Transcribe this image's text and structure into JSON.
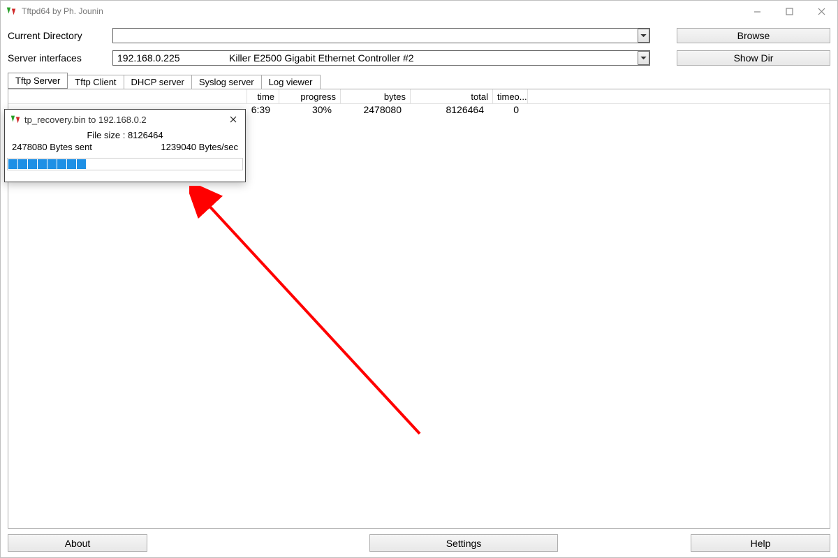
{
  "titlebar": {
    "title": "Tftpd64 by Ph. Jounin"
  },
  "form": {
    "dir_label": "Current Directory",
    "dir_value": "",
    "iface_label": "Server interfaces",
    "iface_ip": "192.168.0.225",
    "iface_name": "Killer E2500 Gigabit Ethernet Controller #2",
    "browse_label": "Browse",
    "showdir_label": "Show Dir"
  },
  "tabs": [
    "Tftp Server",
    "Tftp Client",
    "DHCP server",
    "Syslog server",
    "Log viewer"
  ],
  "table": {
    "headers": {
      "time": "time",
      "progress": "progress",
      "bytes": "bytes",
      "total": "total",
      "timeo": "timeo..."
    },
    "row": {
      "time": "6:39",
      "progress": "30%",
      "bytes": "2478080",
      "total": "8126464",
      "timeo": "0"
    }
  },
  "popup": {
    "title": "tp_recovery.bin to 192.168.0.2",
    "filesize_line": "File size : 8126464",
    "bytes_sent": "2478080 Bytes sent",
    "speed": "1239040 Bytes/sec",
    "progress_pct": 30
  },
  "bottom": {
    "about": "About",
    "settings": "Settings",
    "help": "Help"
  }
}
